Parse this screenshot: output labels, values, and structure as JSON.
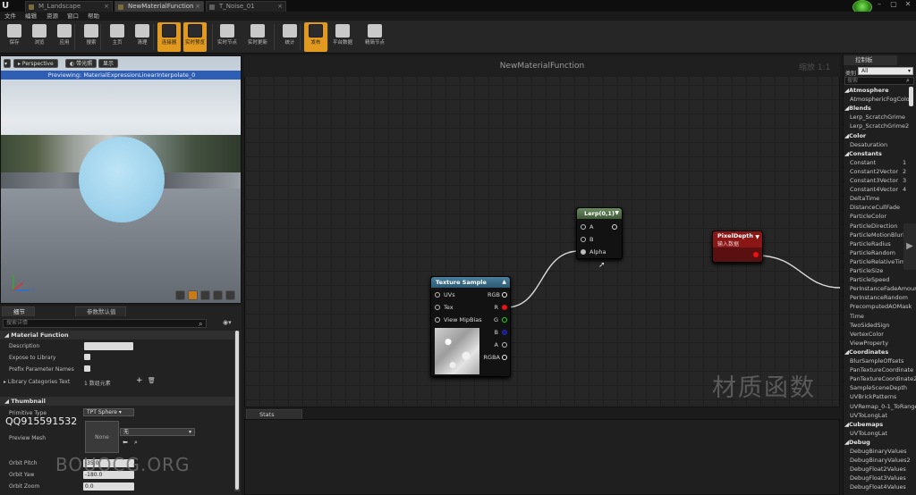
{
  "tabs": [
    {
      "label": "M_Landscape",
      "active": false
    },
    {
      "label": "NewMaterialFunction",
      "active": true
    },
    {
      "label": "T_Noise_01",
      "active": false
    }
  ],
  "window": {
    "minimize": "–",
    "maximize": "▢",
    "close": "✕"
  },
  "menu": [
    "文件",
    "编辑",
    "资源",
    "窗口",
    "帮助"
  ],
  "toolbar": [
    {
      "label": "保存",
      "icon": "save-icon",
      "active": false
    },
    {
      "label": "浏览",
      "icon": "browse-icon",
      "active": false
    },
    {
      "label": "应用",
      "icon": "apply-icon",
      "active": false
    },
    {
      "label": "搜索",
      "icon": "search-icon",
      "active": false
    },
    {
      "label": "主页",
      "icon": "home-icon",
      "active": false
    },
    {
      "label": "清理",
      "icon": "clean-icon",
      "active": false
    },
    {
      "label": "连接器",
      "icon": "connectors-icon",
      "active": true
    },
    {
      "label": "实时预览",
      "icon": "live-preview-icon",
      "active": true
    },
    {
      "label": "实时节点",
      "icon": "live-nodes-icon",
      "active": false
    },
    {
      "label": "实时更新",
      "icon": "live-update-icon",
      "active": false
    },
    {
      "label": "统计",
      "icon": "stats-icon",
      "active": false
    },
    {
      "label": "发布",
      "icon": "release-icon",
      "active": true
    },
    {
      "label": "平台数据",
      "icon": "platform-stats-icon",
      "active": false
    },
    {
      "label": "精简节点",
      "icon": "hide-pins-icon",
      "active": false
    }
  ],
  "viewport": {
    "perspective": "Perspective",
    "lit": "带光照",
    "show": "显示",
    "preview": "Previewing: MaterialExpressionLinearInterpolate_0"
  },
  "details": {
    "tab_details": "细节",
    "tab_params": "参数默认值",
    "search_placeholder": "搜索详情",
    "section_mf": "Material Function",
    "description_label": "Description",
    "expose_label": "Expose to Library",
    "prefix_label": "Prefix Parameter Names",
    "library_categories_label": "Library Categories Text",
    "library_categories_value": "1 数组元素",
    "section_thumb": "Thumbnail",
    "primitive_label": "Primitive Type",
    "primitive_value": "TPT Sphere",
    "preview_mesh_label": "Preview Mesh",
    "preview_mesh_thumb": "None",
    "preview_mesh_value": "无",
    "orbit_pitch_label": "Orbit Pitch",
    "orbit_pitch_value": "-35.0",
    "orbit_yaw_label": "Orbit Yaw",
    "orbit_yaw_value": "-180.0",
    "orbit_zoom_label": "Orbit Zoom",
    "orbit_zoom_value": "0.0"
  },
  "overlay": {
    "credit": "QQ915591532",
    "site": "BOUOCG.ORG"
  },
  "graph": {
    "title": "NewMaterialFunction",
    "zoom": "缩放 1:1",
    "watermark": "材质函数",
    "lerp": {
      "title": "Lerp(0,1)",
      "pins": [
        "A",
        "B",
        "Alpha"
      ]
    },
    "pixeldepth": {
      "title": "PixelDepth",
      "subtitle": "输入数据"
    },
    "texture": {
      "title": "Texture Sample",
      "inputs": [
        "UVs",
        "Tex",
        "View MipBias"
      ],
      "outputs": [
        "RGB",
        "R",
        "G",
        "B",
        "A",
        "RGBA"
      ]
    }
  },
  "stats": {
    "tab": "Stats"
  },
  "palette": {
    "tab": "控制板",
    "filter_label": "类别",
    "filter_value": "All",
    "search_placeholder": "搜索",
    "items": [
      {
        "t": "cat",
        "label": "Atmosphere"
      },
      {
        "t": "item",
        "label": "AtmosphericFogColor"
      },
      {
        "t": "cat",
        "label": "Blends"
      },
      {
        "t": "item",
        "label": "Lerp_ScratchGrime"
      },
      {
        "t": "item",
        "label": "Lerp_ScratchGrime2"
      },
      {
        "t": "cat",
        "label": "Color"
      },
      {
        "t": "item",
        "label": "Desaturation"
      },
      {
        "t": "cat",
        "label": "Constants"
      },
      {
        "t": "item",
        "label": "Constant",
        "n": "1"
      },
      {
        "t": "item",
        "label": "Constant2Vector",
        "n": "2"
      },
      {
        "t": "item",
        "label": "Constant3Vector",
        "n": "3"
      },
      {
        "t": "item",
        "label": "Constant4Vector",
        "n": "4"
      },
      {
        "t": "item",
        "label": "DeltaTime"
      },
      {
        "t": "item",
        "label": "DistanceCullFade"
      },
      {
        "t": "item",
        "label": "ParticleColor"
      },
      {
        "t": "item",
        "label": "ParticleDirection"
      },
      {
        "t": "item",
        "label": "ParticleMotionBlurFade"
      },
      {
        "t": "item",
        "label": "ParticleRadius"
      },
      {
        "t": "item",
        "label": "ParticleRandom"
      },
      {
        "t": "item",
        "label": "ParticleRelativeTime"
      },
      {
        "t": "item",
        "label": "ParticleSize"
      },
      {
        "t": "item",
        "label": "ParticleSpeed"
      },
      {
        "t": "item",
        "label": "PerInstanceFadeAmount"
      },
      {
        "t": "item",
        "label": "PerInstanceRandom"
      },
      {
        "t": "item",
        "label": "PrecomputedAOMask"
      },
      {
        "t": "item",
        "label": "Time"
      },
      {
        "t": "item",
        "label": "TwoSidedSign"
      },
      {
        "t": "item",
        "label": "VertexColor"
      },
      {
        "t": "item",
        "label": "ViewProperty"
      },
      {
        "t": "cat",
        "label": "Coordinates"
      },
      {
        "t": "item",
        "label": "BlurSampleOffsets"
      },
      {
        "t": "item",
        "label": "PanTextureCoordinate"
      },
      {
        "t": "item",
        "label": "PanTextureCoordinate2"
      },
      {
        "t": "item",
        "label": "SampleSceneDepth"
      },
      {
        "t": "item",
        "label": "UVBrickPatterns"
      },
      {
        "t": "item",
        "label": "UVRemap_0-1_ToRange"
      },
      {
        "t": "item",
        "label": "UVToLongLat"
      },
      {
        "t": "cat",
        "label": "Cubemaps"
      },
      {
        "t": "item",
        "label": "UVToLongLat"
      },
      {
        "t": "cat",
        "label": "Debug"
      },
      {
        "t": "item",
        "label": "DebugBinaryValues"
      },
      {
        "t": "item",
        "label": "DebugBinaryValues2"
      },
      {
        "t": "item",
        "label": "DebugFloat2Values"
      },
      {
        "t": "item",
        "label": "DebugFloat3Values"
      },
      {
        "t": "item",
        "label": "DebugFloat4Values"
      }
    ]
  }
}
